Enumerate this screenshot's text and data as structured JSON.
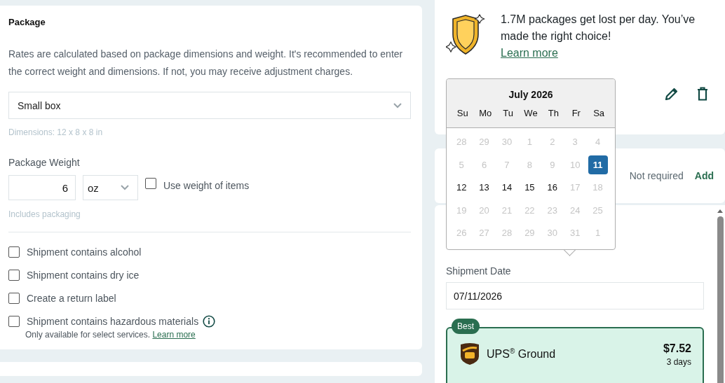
{
  "package": {
    "title": "Package",
    "description": "Rates are calculated based on package dimensions and weight. It's recommended to enter the correct weight and dimensions. If not, you may receive adjustment charges.",
    "package_type": {
      "value": "Small box"
    },
    "dimensions_hint": "Dimensions: 12 x 8 x 8 in",
    "weight": {
      "label": "Package Weight",
      "value": "6",
      "unit": "oz",
      "use_items": {
        "label": "Use weight of items",
        "checked": false
      },
      "hint": "Includes packaging"
    },
    "options": [
      {
        "label": "Shipment contains alcohol",
        "checked": false
      },
      {
        "label": "Shipment contains dry ice",
        "checked": false
      },
      {
        "label": "Create a return label",
        "checked": false
      },
      {
        "label": "Shipment contains hazardous materials",
        "checked": false,
        "info": true,
        "note": "Only available for select services.",
        "note_link": "Learn more"
      }
    ]
  },
  "insurance": {
    "message": "1.7M packages get lost per day. You’ve made the right choice!",
    "link": "Learn more"
  },
  "signature": {
    "status": "Not required",
    "action": "Add"
  },
  "calendar": {
    "title": "July 2026",
    "weekdays": [
      "Su",
      "Mo",
      "Tu",
      "We",
      "Th",
      "Fr",
      "Sa"
    ],
    "days": [
      {
        "label": "28",
        "disabled": true,
        "selected": false
      },
      {
        "label": "29",
        "disabled": true,
        "selected": false
      },
      {
        "label": "30",
        "disabled": true,
        "selected": false
      },
      {
        "label": "1",
        "disabled": true,
        "selected": false
      },
      {
        "label": "2",
        "disabled": true,
        "selected": false
      },
      {
        "label": "3",
        "disabled": true,
        "selected": false
      },
      {
        "label": "4",
        "disabled": true,
        "selected": false
      },
      {
        "label": "5",
        "disabled": true,
        "selected": false
      },
      {
        "label": "6",
        "disabled": true,
        "selected": false
      },
      {
        "label": "7",
        "disabled": true,
        "selected": false
      },
      {
        "label": "8",
        "disabled": true,
        "selected": false
      },
      {
        "label": "9",
        "disabled": true,
        "selected": false
      },
      {
        "label": "10",
        "disabled": true,
        "selected": false
      },
      {
        "label": "11",
        "disabled": false,
        "selected": true
      },
      {
        "label": "12",
        "disabled": false,
        "selected": false
      },
      {
        "label": "13",
        "disabled": false,
        "selected": false
      },
      {
        "label": "14",
        "disabled": false,
        "selected": false
      },
      {
        "label": "15",
        "disabled": false,
        "selected": false
      },
      {
        "label": "16",
        "disabled": false,
        "selected": false
      },
      {
        "label": "17",
        "disabled": true,
        "selected": false
      },
      {
        "label": "18",
        "disabled": true,
        "selected": false
      },
      {
        "label": "19",
        "disabled": true,
        "selected": false
      },
      {
        "label": "20",
        "disabled": true,
        "selected": false
      },
      {
        "label": "21",
        "disabled": true,
        "selected": false
      },
      {
        "label": "22",
        "disabled": true,
        "selected": false
      },
      {
        "label": "23",
        "disabled": true,
        "selected": false
      },
      {
        "label": "24",
        "disabled": true,
        "selected": false
      },
      {
        "label": "25",
        "disabled": true,
        "selected": false
      },
      {
        "label": "26",
        "disabled": true,
        "selected": false
      },
      {
        "label": "27",
        "disabled": true,
        "selected": false
      },
      {
        "label": "28",
        "disabled": true,
        "selected": false
      },
      {
        "label": "29",
        "disabled": true,
        "selected": false
      },
      {
        "label": "30",
        "disabled": true,
        "selected": false
      },
      {
        "label": "31",
        "disabled": true,
        "selected": false
      },
      {
        "label": "1",
        "disabled": true,
        "selected": false
      }
    ]
  },
  "shipment_date": {
    "label": "Shipment Date",
    "value": "07/11/2026"
  },
  "rates": [
    {
      "badge": "Best",
      "service": "UPS$^{®}$ Ground",
      "price": "$7.52",
      "transit": "3 days",
      "selected": true
    }
  ]
}
